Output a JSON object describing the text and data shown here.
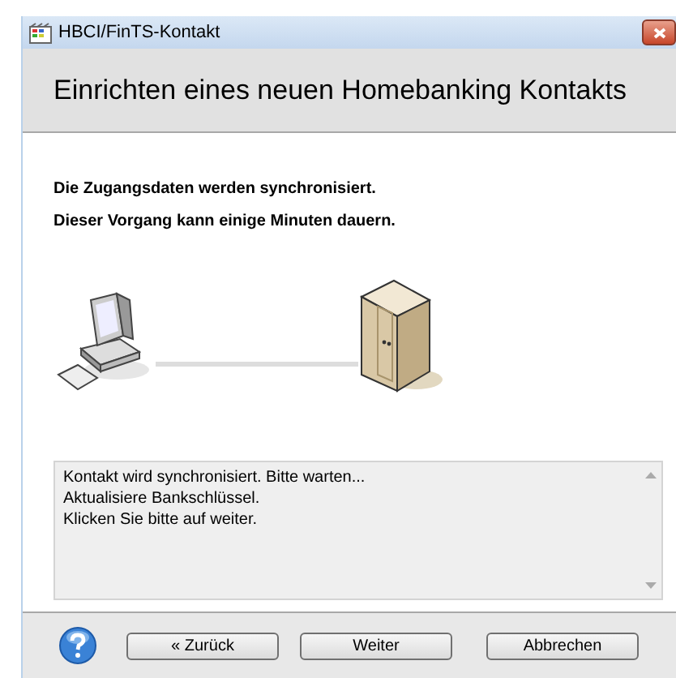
{
  "window": {
    "title": "HBCI/FinTS-Kontakt"
  },
  "header": {
    "title": "Einrichten eines neuen Homebanking Kontakts"
  },
  "intro": [
    "Die Zugangsdaten werden synchronisiert.",
    "Dieser Vorgang kann einige Minuten dauern."
  ],
  "log": [
    "Kontakt wird synchronisiert. Bitte warten...",
    "Aktualisiere Bankschlüssel.",
    "Klicken Sie bitte auf weiter."
  ],
  "buttons": [
    {
      "label": "« Zurück"
    },
    {
      "label": "Weiter"
    },
    {
      "label": "Abbrechen"
    }
  ]
}
